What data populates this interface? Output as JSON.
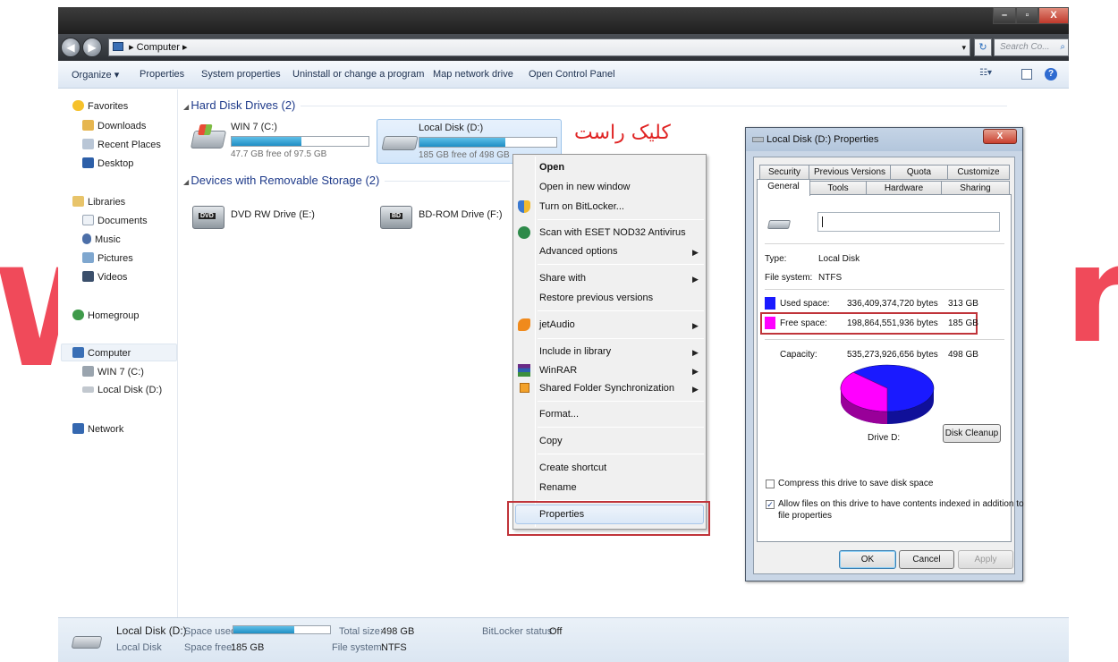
{
  "window": {
    "buttons": {
      "minimize": "–",
      "maximize": "▫",
      "close": "X"
    }
  },
  "address": {
    "path": "Computer",
    "search_placeholder": "Search Co...",
    "back_glyph": "◀",
    "forward_glyph": "▶"
  },
  "toolbar": {
    "items": [
      "Organize ▾",
      "Properties",
      "System properties",
      "Uninstall or change a program",
      "Map network drive",
      "Open Control Panel"
    ]
  },
  "nav": {
    "favorites": "Favorites",
    "downloads": "Downloads",
    "recent_places": "Recent Places",
    "desktop": "Desktop",
    "libraries": "Libraries",
    "documents": "Documents",
    "music": "Music",
    "pictures": "Pictures",
    "videos": "Videos",
    "homegroup": "Homegroup",
    "computer": "Computer",
    "win7": "WIN 7 (C:)",
    "local_disk": "Local Disk (D:)",
    "network": "Network"
  },
  "content": {
    "hdd_header": "Hard Disk Drives (2)",
    "removable_header": "Devices with Removable Storage (2)",
    "drives": [
      {
        "name": "WIN 7 (C:)",
        "free": "47.7 GB free of 97.5 GB",
        "used_fraction": 0.51
      },
      {
        "name": "Local Disk (D:)",
        "free": "185 GB free of 498 GB",
        "used_fraction": 0.63
      }
    ],
    "removable": [
      {
        "name": "DVD RW Drive (E:)",
        "badge": "DVD"
      },
      {
        "name": "BD-ROM Drive (F:)",
        "badge": "BD"
      }
    ]
  },
  "annotation": "کلیک راست",
  "context_menu": {
    "open": "Open",
    "open_new_window": "Open in new window",
    "bitlocker": "Turn on BitLocker...",
    "eset": "Scan with ESET NOD32 Antivirus",
    "advanced": "Advanced options",
    "share_with": "Share with",
    "restore": "Restore previous versions",
    "jetaudio": "jetAudio",
    "include_library": "Include in library",
    "winrar": "WinRAR",
    "shared_folder_sync": "Shared Folder Synchronization",
    "format": "Format...",
    "copy": "Copy",
    "create_shortcut": "Create shortcut",
    "rename": "Rename",
    "properties": "Properties",
    "submenu_arrow": "▶"
  },
  "dialog": {
    "title": "Local Disk (D:) Properties",
    "close": "X",
    "tabs_row1": [
      "Security",
      "Previous Versions",
      "Quota",
      "Customize"
    ],
    "tabs_row2": [
      "General",
      "Tools",
      "Hardware",
      "Sharing"
    ],
    "name_value": "",
    "type_label": "Type:",
    "type_value": "Local Disk",
    "fs_label": "File system:",
    "fs_value": "NTFS",
    "used_label": "Used space:",
    "used_bytes": "336,409,374,720 bytes",
    "used_gb": "313 GB",
    "free_label": "Free space:",
    "free_bytes": "198,864,551,936 bytes",
    "free_gb": "185 GB",
    "capacity_label": "Capacity:",
    "capacity_bytes": "535,273,926,656 bytes",
    "capacity_gb": "498 GB",
    "drive_label": "Drive D:",
    "disk_cleanup": "Disk Cleanup",
    "compress": "Compress this drive to save disk space",
    "allow_index_line1": "Allow files on this drive to have contents indexed in addition to",
    "allow_index_line2": "file properties",
    "ok": "OK",
    "cancel": "Cancel",
    "apply": "Apply",
    "used_color": "#1a1aff",
    "free_color": "#ff00ff",
    "used_fraction": 0.63
  },
  "details": {
    "name": "Local Disk (D:)",
    "type": "Local Disk",
    "space_used_label": "Space used:",
    "space_free_label": "Space free:",
    "space_free_value": "185 GB",
    "total_size_label": "Total size:",
    "total_size_value": "498 GB",
    "fs_label": "File system:",
    "fs_value": "NTFS",
    "bitlocker_label": "BitLocker status:",
    "bitlocker_value": "Off",
    "used_fraction": 0.63
  },
  "watermark": {
    "left": "W",
    "right": "r"
  }
}
